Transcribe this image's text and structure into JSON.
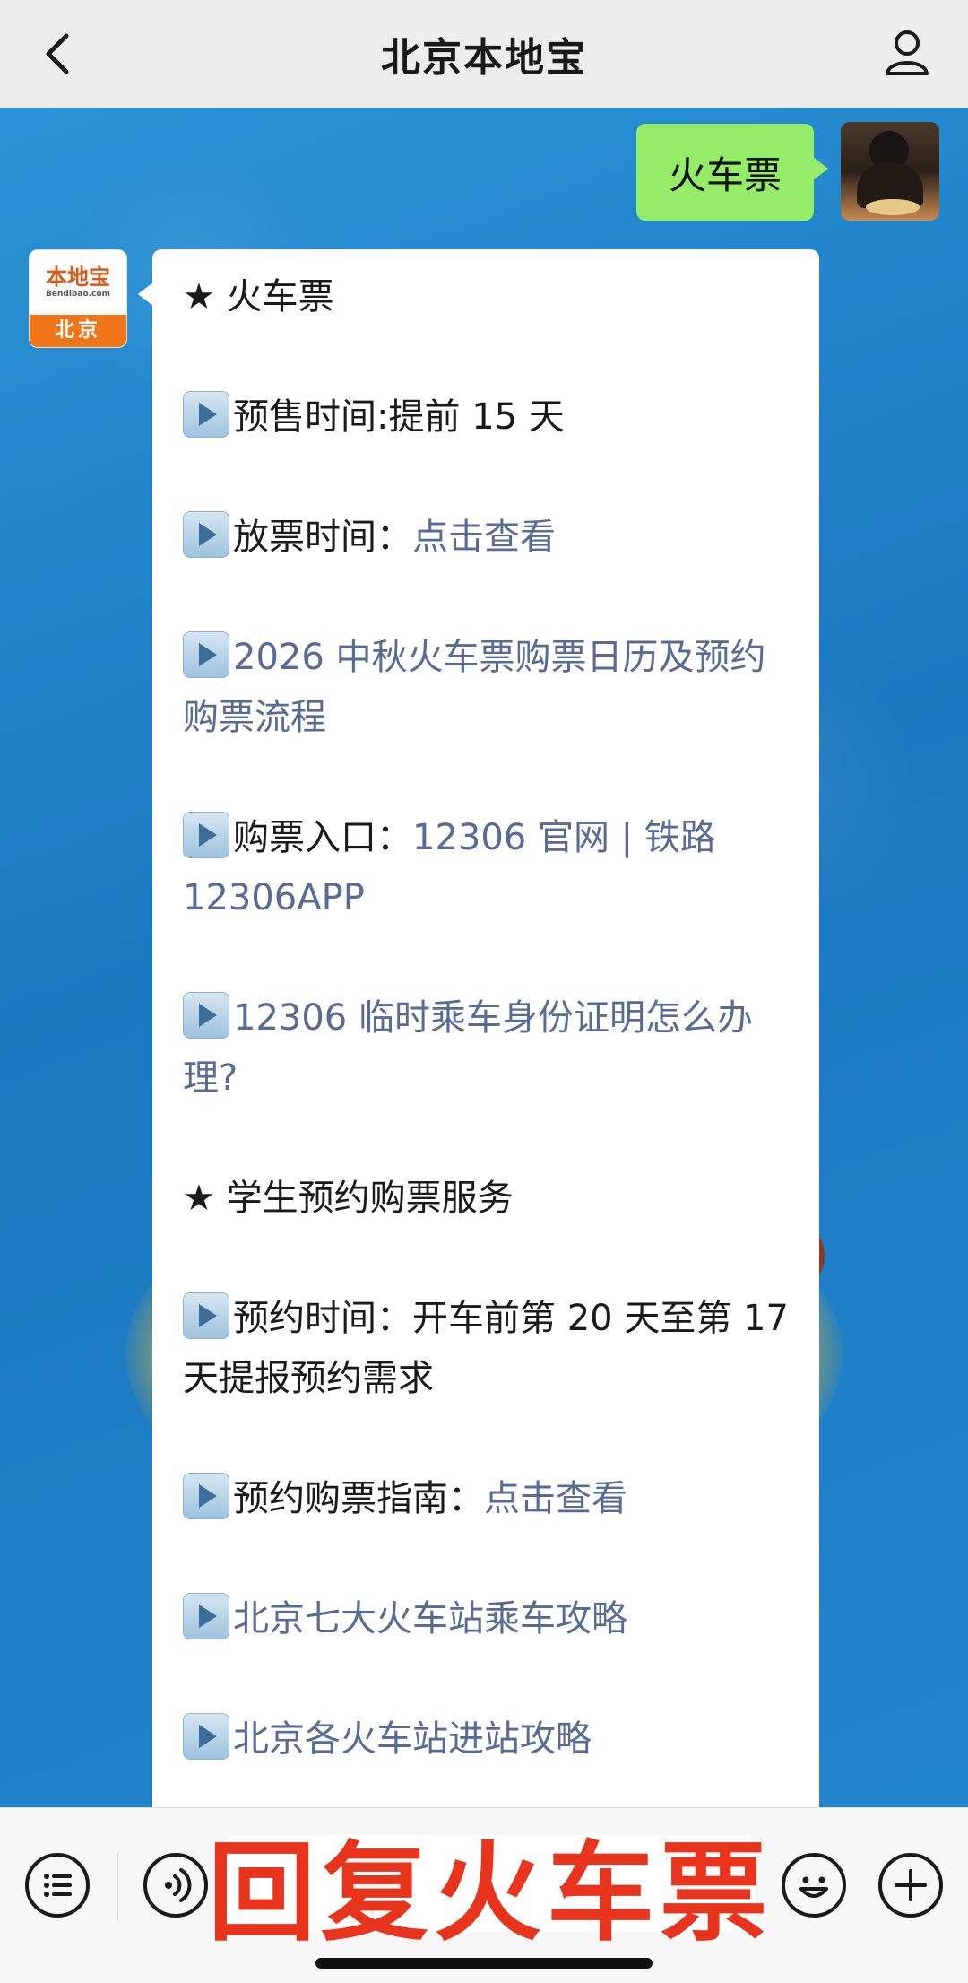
{
  "header": {
    "title": "北京本地宝",
    "back_icon": "chevron-left-icon",
    "profile_icon": "user-icon"
  },
  "user_message": {
    "text": "火车票"
  },
  "bot_avatar": {
    "logo_text": "本地宝",
    "logo_sub": "Bendibao.com",
    "city": "北京"
  },
  "bot_message": {
    "sections": [
      {
        "type": "heading",
        "text": "★ 火车票"
      },
      {
        "type": "item",
        "text": "预售时间:提前 15 天",
        "link": ""
      },
      {
        "type": "item",
        "text": "放票时间：",
        "link": "点击查看"
      },
      {
        "type": "item",
        "text": "",
        "link": "2026 中秋火车票购票日历及预约购票流程"
      },
      {
        "type": "item",
        "text": "购票入口：",
        "link": "12306 官网 | 铁路 12306APP"
      },
      {
        "type": "item",
        "text": "",
        "link": "12306 临时乘车身份证明怎么办理?"
      },
      {
        "type": "heading",
        "text": "★ 学生预约购票服务"
      },
      {
        "type": "item",
        "text": "预约时间：开车前第 20 天至第 17 天提报预约需求",
        "link": ""
      },
      {
        "type": "item",
        "text": "预约购票指南：",
        "link": "点击查看"
      },
      {
        "type": "item",
        "text": "",
        "link": "北京七大火车站乘车攻略"
      },
      {
        "type": "item",
        "text": "",
        "link": "北京各火车站进站攻略"
      }
    ]
  },
  "bottom_bar": {
    "overlay_text": "回复火车票",
    "menu_icon": "list-menu-icon",
    "voice_icon": "voice-icon",
    "emoji_icon": "emoji-icon",
    "plus_icon": "plus-icon"
  },
  "colors": {
    "link": "#576b95",
    "user_bubble": "#95ec69",
    "overlay": "#e8341c",
    "header_bg": "#ededed"
  }
}
